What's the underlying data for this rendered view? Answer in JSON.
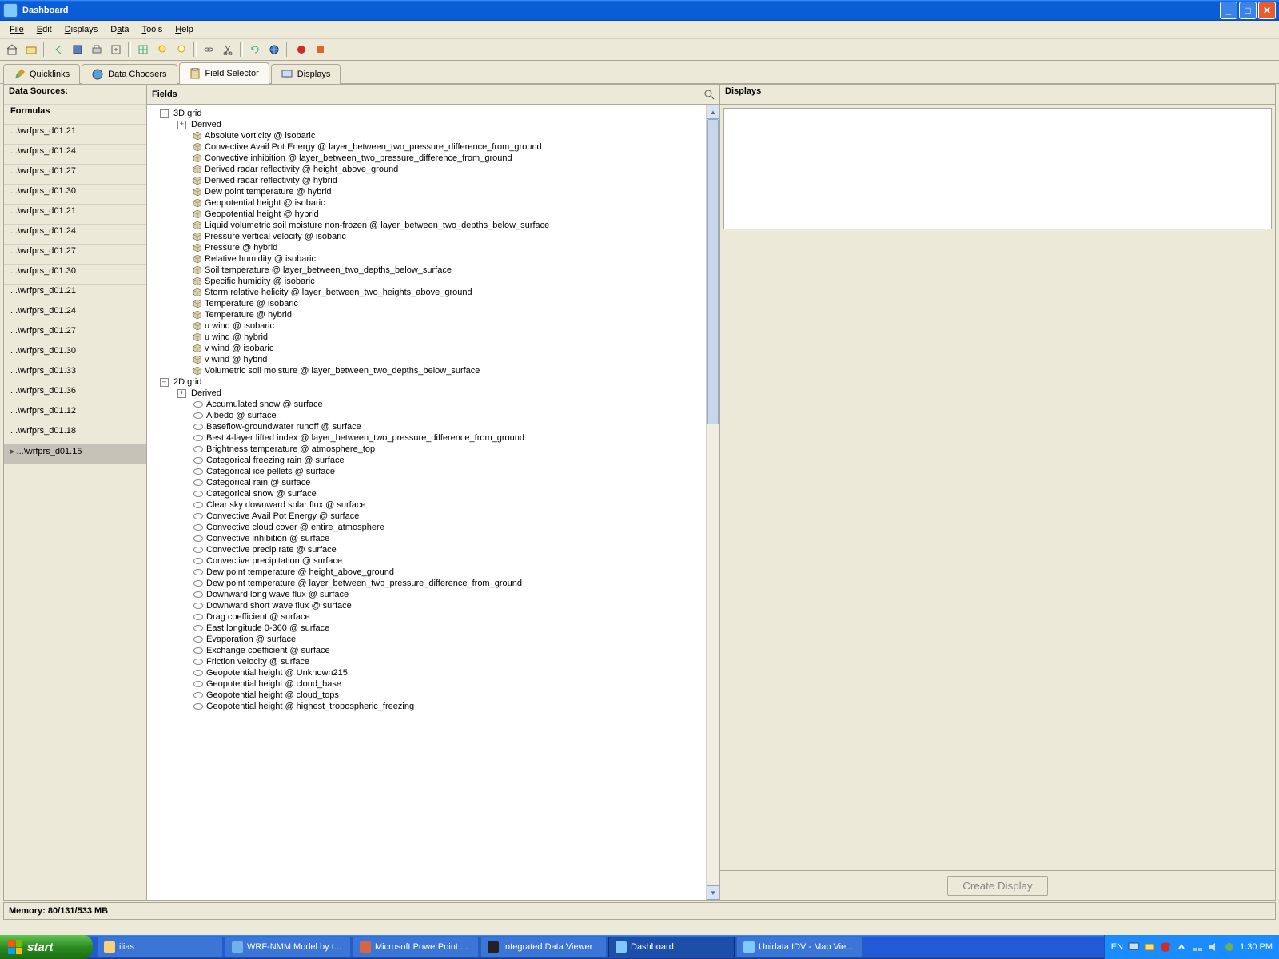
{
  "window": {
    "title": "Dashboard"
  },
  "menu": {
    "file": "File",
    "edit": "Edit",
    "displays": "Displays",
    "data": "Data",
    "tools": "Tools",
    "help": "Help"
  },
  "tabs": {
    "quicklinks": "Quicklinks",
    "datachoosers": "Data Choosers",
    "fieldselector": "Field Selector",
    "displays": "Displays"
  },
  "leftpane": {
    "header": "Data Sources:",
    "formulas": "Formulas",
    "items": [
      "...\\wrfprs_d01.21",
      "...\\wrfprs_d01.24",
      "...\\wrfprs_d01.27",
      "...\\wrfprs_d01.30",
      "...\\wrfprs_d01.21",
      "...\\wrfprs_d01.24",
      "...\\wrfprs_d01.27",
      "...\\wrfprs_d01.30",
      "...\\wrfprs_d01.21",
      "...\\wrfprs_d01.24",
      "...\\wrfprs_d01.27",
      "...\\wrfprs_d01.30",
      "...\\wrfprs_d01.33",
      "...\\wrfprs_d01.36",
      "...\\wrfprs_d01.12",
      "...\\wrfprs_d01.18",
      "...\\wrfprs_d01.15"
    ],
    "selected_index": 16
  },
  "midpane": {
    "header": "Fields"
  },
  "tree": {
    "grid3d": "3D grid",
    "derived": "Derived",
    "grid2d": "2D grid",
    "items3d": [
      "Absolute vorticity @ isobaric",
      "Convective Avail Pot Energy @ layer_between_two_pressure_difference_from_ground",
      "Convective inhibition @ layer_between_two_pressure_difference_from_ground",
      "Derived radar reflectivity @ height_above_ground",
      "Derived radar reflectivity @ hybrid",
      "Dew point temperature @ hybrid",
      "Geopotential height @ isobaric",
      "Geopotential height @ hybrid",
      "Liquid volumetric soil moisture non-frozen @ layer_between_two_depths_below_surface",
      "Pressure vertical velocity @ isobaric",
      "Pressure @ hybrid",
      "Relative humidity @ isobaric",
      "Soil temperature @ layer_between_two_depths_below_surface",
      "Specific humidity @ isobaric",
      "Storm relative helicity @ layer_between_two_heights_above_ground",
      "Temperature @ isobaric",
      "Temperature @ hybrid",
      "u wind @ isobaric",
      "u wind @ hybrid",
      "v wind @ isobaric",
      "v wind @ hybrid",
      "Volumetric soil moisture @ layer_between_two_depths_below_surface"
    ],
    "items2d": [
      "Accumulated snow @ surface",
      "Albedo @ surface",
      "Baseflow-groundwater runoff @ surface",
      "Best 4-layer lifted index @ layer_between_two_pressure_difference_from_ground",
      "Brightness temperature @ atmosphere_top",
      "Categorical freezing rain @ surface",
      "Categorical ice pellets @ surface",
      "Categorical rain @ surface",
      "Categorical snow @ surface",
      "Clear sky downward solar flux @ surface",
      "Convective Avail Pot Energy @ surface",
      "Convective cloud cover @ entire_atmosphere",
      "Convective inhibition @ surface",
      "Convective precip rate @ surface",
      "Convective precipitation @ surface",
      "Dew point temperature @ height_above_ground",
      "Dew point temperature @ layer_between_two_pressure_difference_from_ground",
      "Downward long wave flux @ surface",
      "Downward short wave flux @ surface",
      "Drag coefficient @ surface",
      "East longitude 0-360 @ surface",
      "Evaporation @ surface",
      "Exchange coefficient @ surface",
      "Friction velocity @ surface",
      "Geopotential height @ Unknown215",
      "Geopotential height @ cloud_base",
      "Geopotential height @ cloud_tops",
      "Geopotential height @ highest_tropospheric_freezing"
    ]
  },
  "rightpane": {
    "header": "Displays"
  },
  "create_btn": "Create Display",
  "status": {
    "memory": "Memory: 80/131/533 MB"
  },
  "taskbar": {
    "start": "start",
    "items": [
      {
        "label": "ilias",
        "color": "#f7d27a"
      },
      {
        "label": "WRF-NMM Model by t...",
        "color": "#6fb1e8"
      },
      {
        "label": "Microsoft PowerPoint ...",
        "color": "#d4673f"
      },
      {
        "label": "Integrated Data Viewer",
        "color": "#222"
      },
      {
        "label": "Dashboard",
        "color": "#7fc9ff"
      },
      {
        "label": "Unidata IDV - Map Vie...",
        "color": "#7fc9ff"
      }
    ],
    "active_index": 4,
    "lang": "EN",
    "clock": "1:30 PM"
  }
}
